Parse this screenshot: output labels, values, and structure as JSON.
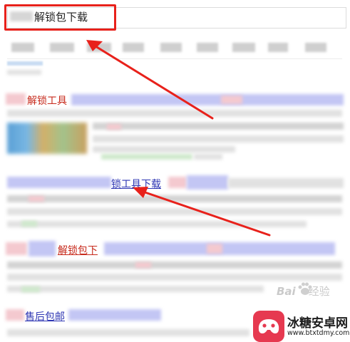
{
  "search": {
    "query": "解锁包下载"
  },
  "results": [
    {
      "title": "解锁工具"
    },
    {
      "title": "锁工具下载"
    },
    {
      "title": "解锁包下"
    },
    {
      "title": "售后包邮"
    }
  ],
  "watermark": {
    "baidu": "Bai",
    "baidu_suffix": "经验"
  },
  "brand": {
    "name": "冰糖安卓网",
    "url": "www.btxtdmy.com"
  },
  "colors": {
    "highlight": "#e8211b",
    "link_red": "#c72a1c",
    "link_blue": "#2d35b3",
    "brand": "#e63950"
  }
}
